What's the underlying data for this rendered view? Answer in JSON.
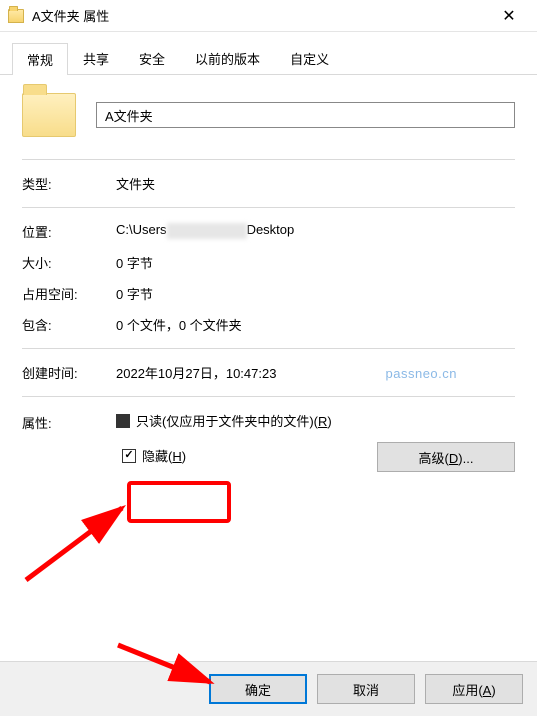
{
  "window": {
    "title": "A文件夹 属性"
  },
  "tabs": [
    "常规",
    "共享",
    "安全",
    "以前的版本",
    "自定义"
  ],
  "activeTab": 0,
  "folderName": "A文件夹",
  "rows": {
    "type_label": "类型:",
    "type_value": "文件夹",
    "location_label": "位置:",
    "location_prefix": "C:\\Users",
    "location_suffix": "Desktop",
    "size_label": "大小:",
    "size_value": "0 字节",
    "disk_label": "占用空间:",
    "disk_value": "0 字节",
    "contains_label": "包含:",
    "contains_value": "0 个文件，0 个文件夹",
    "created_label": "创建时间:",
    "created_value": "2022年10月27日，10:47:23"
  },
  "attributes": {
    "label": "属性:",
    "readonly_text_pre": "只读(仅应用于文件夹中的文件)(",
    "readonly_key": "R",
    "readonly_text_post": ")",
    "hidden_text_pre": "隐藏(",
    "hidden_key": "H",
    "hidden_text_post": ")",
    "advanced_pre": "高级(",
    "advanced_key": "D",
    "advanced_post": ")..."
  },
  "buttons": {
    "ok": "确定",
    "cancel": "取消",
    "apply_pre": "应用(",
    "apply_key": "A",
    "apply_post": ")"
  },
  "watermark": "passneo.cn"
}
